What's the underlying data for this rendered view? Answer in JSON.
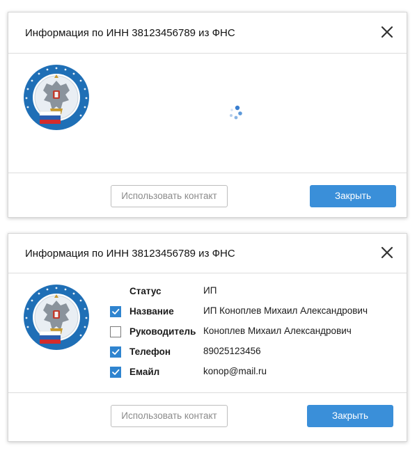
{
  "dialog_loading": {
    "title": "Информация по ИНН 38123456789 из ФНС",
    "close_icon": "close-icon",
    "logo_icon": "fns-emblem-icon",
    "spinner_icon": "loading-spinner-icon",
    "use_contact_label": "Использовать контакт",
    "close_label": "Закрыть"
  },
  "dialog_result": {
    "title": "Информация по ИНН 38123456789 из ФНС",
    "close_icon": "close-icon",
    "logo_icon": "fns-emblem-icon",
    "fields": [
      {
        "label": "Статус",
        "value": "ИП",
        "checkbox": null
      },
      {
        "label": "Название",
        "value": "ИП Коноплев Михаил Александрович",
        "checkbox": true
      },
      {
        "label": "Руководитель",
        "value": "Коноплев Михаил Александрович",
        "checkbox": false
      },
      {
        "label": "Телефон",
        "value": "89025123456",
        "checkbox": true
      },
      {
        "label": "Емайл",
        "value": "konop@mail.ru",
        "checkbox": true
      }
    ],
    "use_contact_label": "Использовать контакт",
    "close_label": "Закрыть"
  },
  "colors": {
    "primary": "#3a8fd9",
    "checkbox": "#2f84cf",
    "logo_ring": "#1f6fb6"
  }
}
